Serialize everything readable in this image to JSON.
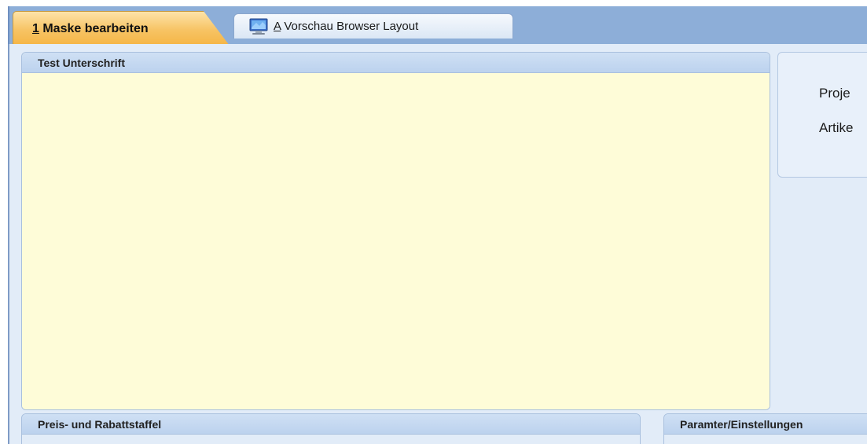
{
  "tabs": [
    {
      "mnemonic": "1",
      "label": " Maske bearbeiten",
      "active": true
    },
    {
      "mnemonic": "A",
      "label": " Vorschau Browser Layout",
      "active": false,
      "icon": "monitor-icon"
    }
  ],
  "panels": {
    "signature": {
      "title": "Test Unterschrift"
    },
    "info": {
      "line1": "Proje",
      "line2": "Artike"
    },
    "price": {
      "title": "Preis- und Rabattstaffel"
    },
    "params": {
      "title": "Paramter/Einstellungen"
    }
  },
  "colors": {
    "active_tab": "#f7c363",
    "tabstrip": "#8daed8",
    "panel_header": "#c6d9f1",
    "signature_background": "#fefcd8",
    "workspace": "#e2ecf8"
  }
}
